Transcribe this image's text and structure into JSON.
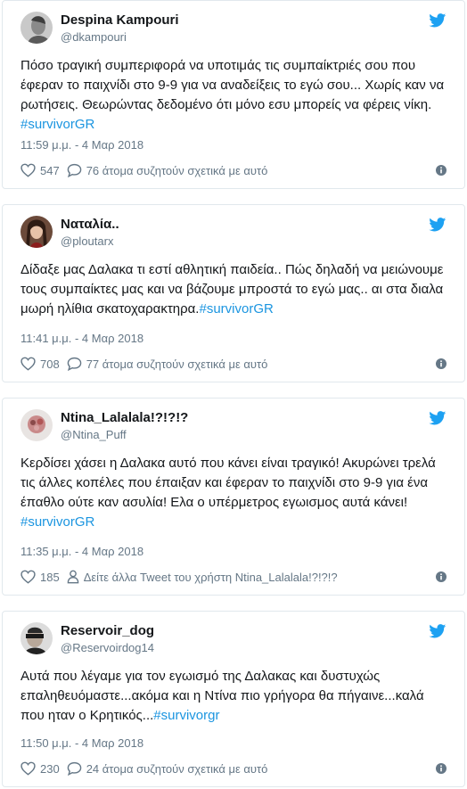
{
  "tweets": [
    {
      "name": "Despina Kampouri",
      "handle": "@dkampouri",
      "text": "Πόσο τραγική συμπεριφορά να υποτιμάς τις συμπαίκτριές σου που έφεραν το παιχνίδι στο 9-9 για να αναδείξεις το εγώ σου... Χωρίς καν να ρωτήσεις. Θεωρώντας δεδομένο ότι μόνο εσυ μπορείς να φέρεις νίκη.",
      "hashtag": "#survivorGR",
      "time": "11:59 μ.μ. - 4 Μαρ 2018",
      "likes": "547",
      "comments": "76 άτομα συζητούν σχετικά με αυτό",
      "avatar_icon": "avatar-photo"
    },
    {
      "name": "Ναταλία..",
      "handle": "@ploutarx",
      "text": "Δίδαξε μας Δαλακα τι εστί αθλητική παιδεία.. Πώς δηλαδή να μειώνουμε τους συμπαίκτες μας και να βάζουμε μπροστά το εγώ μας.. αι στα διαλα μωρή ηλίθια σκατοχαρακτηρα.",
      "hashtag": "#survivorGR",
      "time": "11:41 μ.μ. - 4 Μαρ 2018",
      "likes": "708",
      "comments": "77 άτομα συζητούν σχετικά με αυτό",
      "avatar_icon": "avatar-photo"
    },
    {
      "name": "Ntina_Lalalala!?!?!?",
      "handle": "@Ntina_Puff",
      "text": "Κερδίσει χάσει η Δαλακα αυτό που κάνει είναι τραγικό! Ακυρώνει τρελά τις άλλες κοπέλες που έπαιξαν και έφεραν το παιχνίδι στο 9-9 για ένα έπαθλο ούτε καν ασυλία! Ελα ο υπέρμετρος εγωισμος αυτά κάνει!",
      "hashtag": "#survivorGR",
      "time": "11:35 μ.μ. - 4 Μαρ 2018",
      "likes": "185",
      "comments": "Δείτε άλλα Tweet του χρήστη Ntina_Lalalala!?!?!?",
      "avatar_icon": "avatar-photo"
    },
    {
      "name": "Reservoir_dog",
      "handle": "@Reservoirdog14",
      "text": "Αυτά που λέγαμε για τον εγωισμό της Δαλακας και δυστυχώς επαληθευόμαστε...ακόμα και η Ντίνα πιο γρήγορα θα πήγαινε...καλά που ηταν ο Κρητικός...",
      "hashtag": "#survivorgr",
      "time": "11:50 μ.μ. - 4 Μαρ 2018",
      "likes": "230",
      "comments": "24 άτομα συζητούν σχετικά με αυτό",
      "avatar_icon": "avatar-photo"
    }
  ],
  "icons": {
    "bird": "twitter-bird-icon",
    "like": "heart-icon",
    "comment": "speech-bubble-icon",
    "profile": "person-icon",
    "info": "info-icon"
  },
  "colors": {
    "twitter_blue": "#1da1f2",
    "hashtag": "#1b95e0",
    "secondary_text": "#657786",
    "border": "#e1e8ed"
  }
}
